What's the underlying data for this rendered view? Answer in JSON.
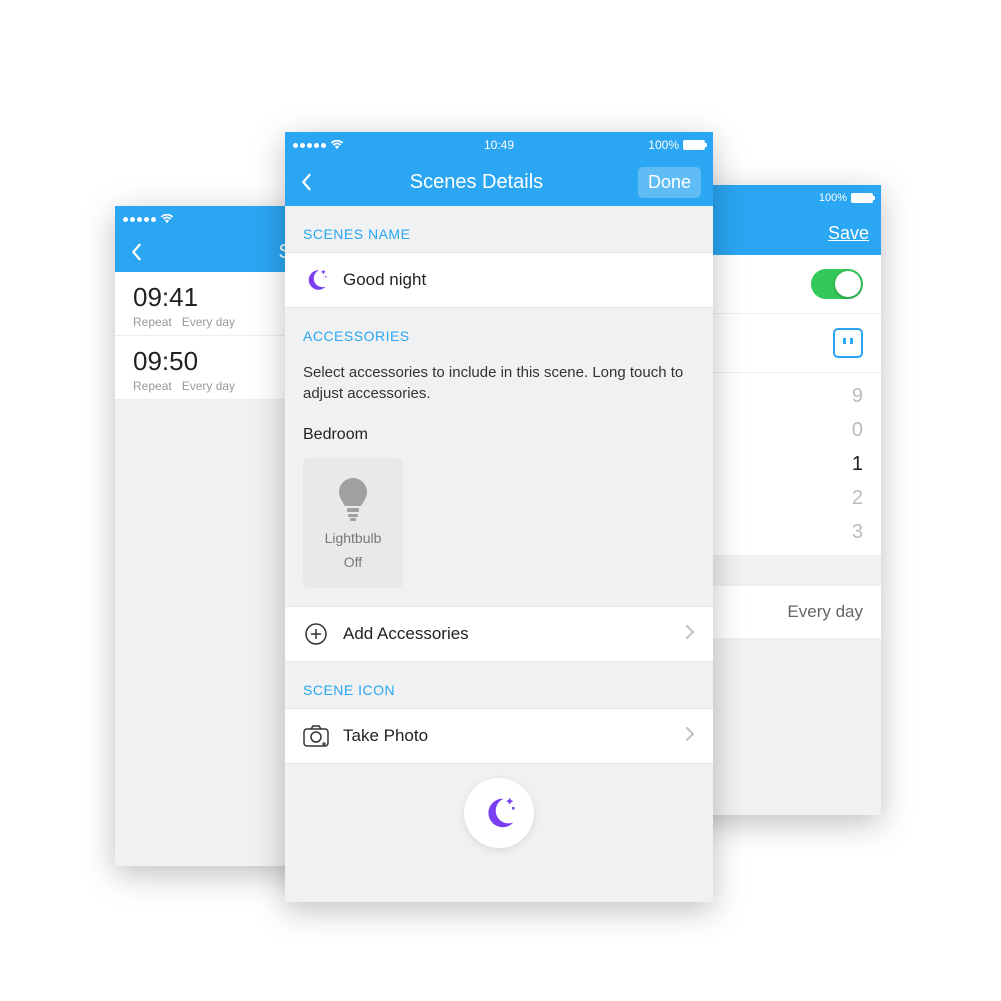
{
  "center": {
    "status": {
      "time": "10:49",
      "battery": "100%"
    },
    "nav": {
      "title": "Scenes Details",
      "done": "Done"
    },
    "section_scenes_name": "SCENES NAME",
    "scene_name": "Good night",
    "section_accessories": "ACCESSORIES",
    "accessories_desc": "Select accessories to include in this scene. Long touch to adjust accessories.",
    "room": "Bedroom",
    "accessory": {
      "name": "Lightbulb",
      "state": "Off"
    },
    "add_accessories": "Add Accessories",
    "section_scene_icon": "SCENE ICON",
    "take_photo": "Take Photo"
  },
  "left": {
    "nav_title_partial": "Se",
    "times": [
      {
        "time": "09:41",
        "repeat_label": "Repeat",
        "repeat_value": "Every day"
      },
      {
        "time": "09:50",
        "repeat_label": "Repeat",
        "repeat_value": "Every day"
      }
    ]
  },
  "right": {
    "status": {
      "battery": "100%"
    },
    "nav": {
      "save": "Save"
    },
    "picker": {
      "v0": "9",
      "v1": "0",
      "selected": "1",
      "v3": "2",
      "v4": "3"
    },
    "everyday": "Every day"
  }
}
